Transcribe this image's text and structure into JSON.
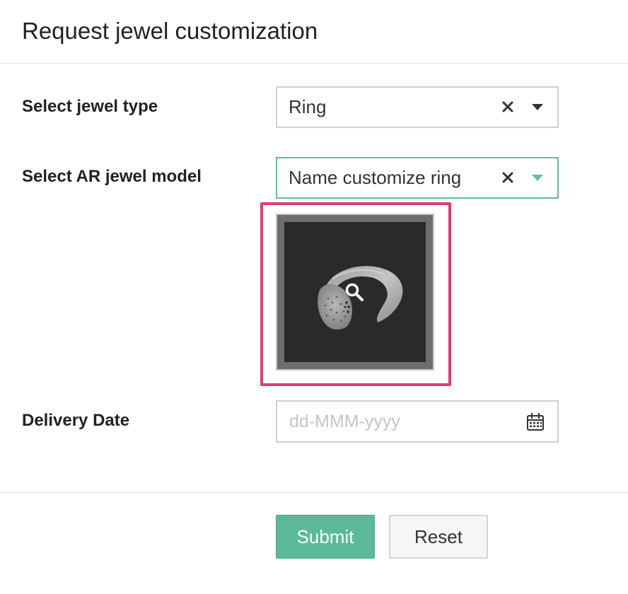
{
  "form": {
    "title": "Request jewel customization",
    "jewel_type": {
      "label": "Select jewel type",
      "value": "Ring"
    },
    "ar_model": {
      "label": "Select AR jewel model",
      "value": "Name customize ring"
    },
    "preview": {
      "icon": "magnifier-icon"
    },
    "delivery_date": {
      "label": "Delivery Date",
      "placeholder": "dd-MMM-yyyy",
      "value": ""
    },
    "buttons": {
      "submit": "Submit",
      "reset": "Reset"
    }
  },
  "colors": {
    "accent": "#5bb99a",
    "highlight": "#e23b76"
  }
}
